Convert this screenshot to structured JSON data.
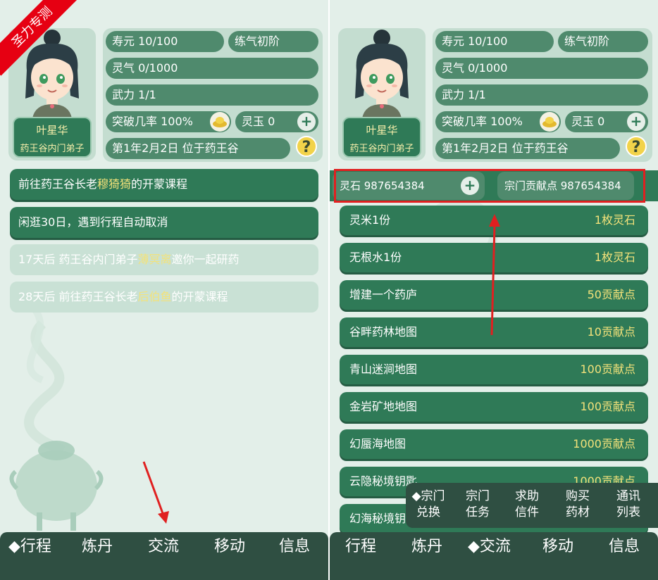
{
  "watermark": "圣力专测",
  "profile": {
    "name": "叶星华",
    "rank": "药王谷内门弟子",
    "lifespan": "寿元 10/100",
    "realm": "练气初阶",
    "spirit_qi": "灵气 0/1000",
    "force": "武力 1/1",
    "breakthrough": "突破几率 100%",
    "jade": "灵玉 0",
    "date_location": "第1年2月2日 位于药王谷",
    "plus_symbol": "+",
    "help_symbol": "?"
  },
  "events": [
    {
      "prefix": "前往药王谷长老",
      "highlight": "穆猗猗",
      "suffix": "的开蒙课程"
    },
    {
      "prefix": "闲逛30日，遇到行程自动取消",
      "highlight": "",
      "suffix": ""
    },
    {
      "prefix": "17天后 药王谷内门弟子",
      "highlight": "薄冥离",
      "suffix": "邀你一起研药"
    },
    {
      "prefix": "28天后 前往药王谷长老",
      "highlight": "后伯鱼",
      "suffix": "的开蒙课程"
    }
  ],
  "left_nav": [
    "◆行程",
    "炼丹",
    "交流",
    "移动",
    "信息"
  ],
  "currency": {
    "spirit_stone": "灵石 987654384",
    "contribution": "宗门贡献点 987654384"
  },
  "shop_items": [
    {
      "name": "灵米1份",
      "price": "1枚灵石"
    },
    {
      "name": "无根水1份",
      "price": "1枚灵石"
    },
    {
      "name": "增建一个药庐",
      "price": "50贡献点"
    },
    {
      "name": "谷畔药林地图",
      "price": "10贡献点"
    },
    {
      "name": "青山迷涧地图",
      "price": "100贡献点"
    },
    {
      "name": "金岩矿地地图",
      "price": "100贡献点"
    },
    {
      "name": "幻蜃海地图",
      "price": "1000贡献点"
    },
    {
      "name": "云隐秘境钥匙",
      "price": "1000贡献点"
    },
    {
      "name": "幻海秘境钥匙",
      "price": ""
    }
  ],
  "sub_nav": [
    {
      "line1": "◆宗门",
      "line2": "兑换"
    },
    {
      "line1": "宗门",
      "line2": "任务"
    },
    {
      "line1": "求助",
      "line2": "信件"
    },
    {
      "line1": "购买",
      "line2": "药材"
    },
    {
      "line1": "通讯",
      "line2": "列表"
    }
  ],
  "right_nav": [
    "行程",
    "炼丹",
    "◆交流",
    "移动",
    "信息"
  ],
  "colors": {
    "primary_green": "#2f7a57",
    "pill_green": "#4f8a6d",
    "highlight_yellow": "#f3e27a",
    "nav_dark": "#2f4f42",
    "annotation_red": "#e02020"
  }
}
